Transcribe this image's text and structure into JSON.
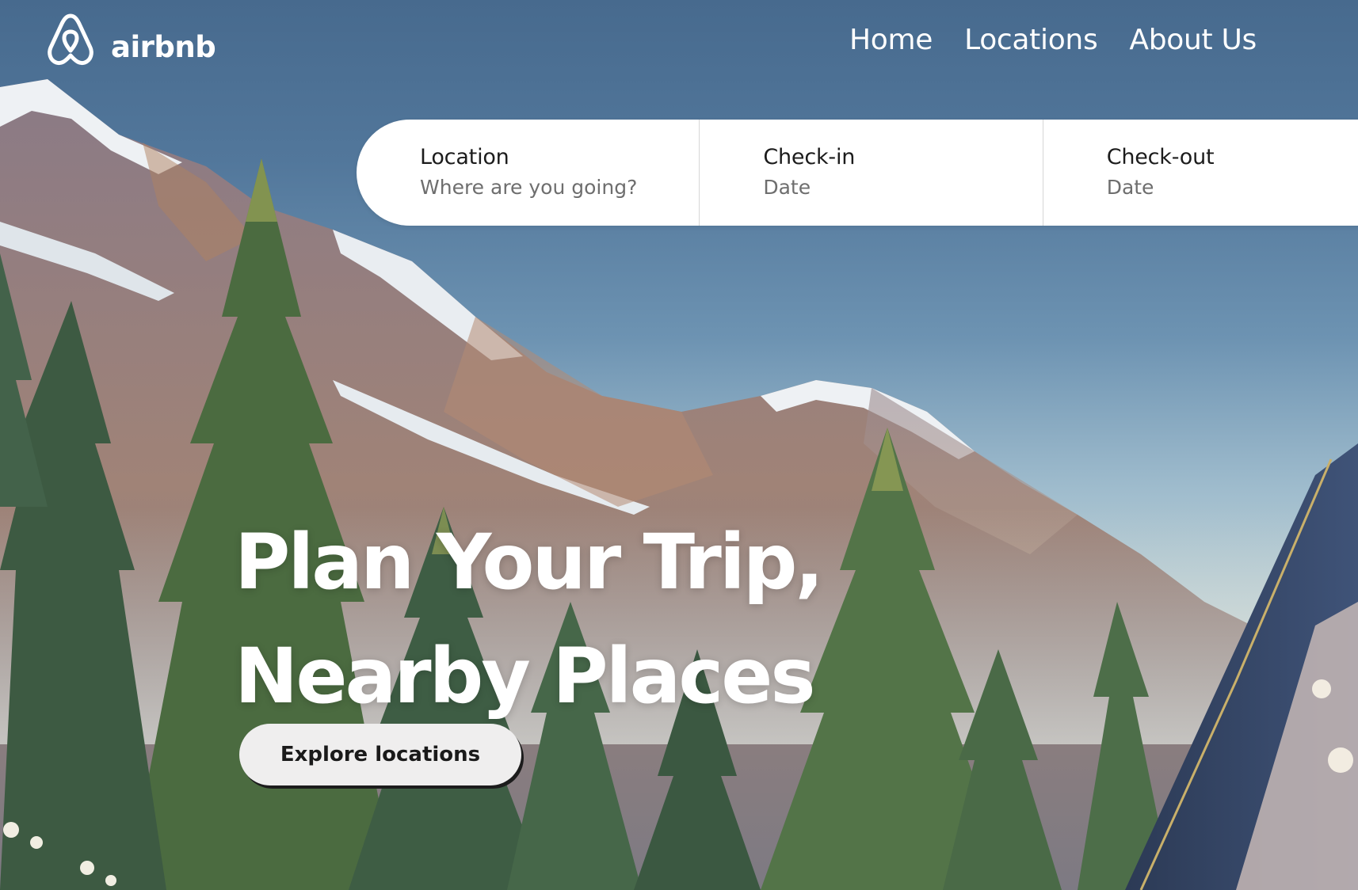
{
  "brand": {
    "name": "airbnb",
    "logo_icon": "airbnb-belo-logo-icon"
  },
  "nav": {
    "items": [
      {
        "label": "Home"
      },
      {
        "label": "Locations"
      },
      {
        "label": "About Us"
      }
    ]
  },
  "search": {
    "fields": [
      {
        "label": "Location",
        "placeholder": "Where are you going?"
      },
      {
        "label": "Check-in",
        "placeholder": "Date"
      },
      {
        "label": "Check-out",
        "placeholder": "Date"
      }
    ]
  },
  "hero": {
    "title_line1": "Plan Your Trip,",
    "title_line2": "Nearby Places",
    "cta_label": "Explore locations"
  },
  "colors": {
    "sky_top": "#476a8e",
    "text_light": "#ffffff",
    "search_bg": "#ffffff",
    "cta_bg": "#efeeee",
    "cta_shadow": "#1c1c1c"
  }
}
